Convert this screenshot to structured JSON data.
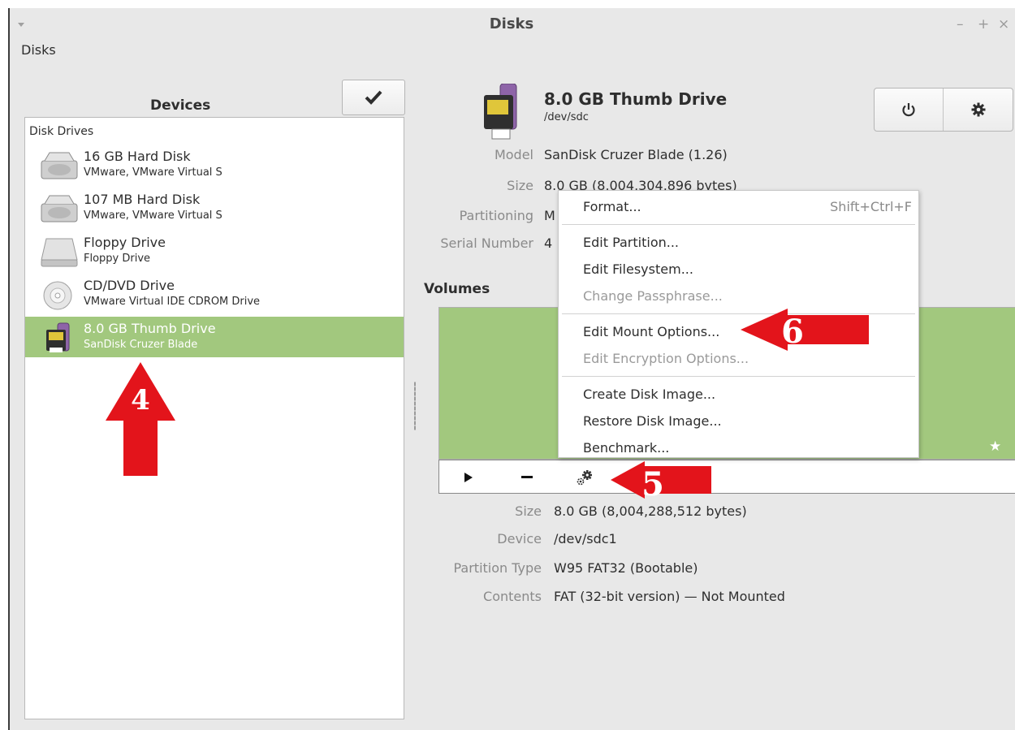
{
  "window": {
    "title": "Disks",
    "menubar_label": "Disks",
    "buttons": {
      "minimize": "–",
      "maximize": "+",
      "close": "×"
    }
  },
  "devices_panel": {
    "header": "Devices",
    "check_icon": "checkmark-icon",
    "section": "Disk Drives",
    "items": [
      {
        "name": "16 GB Hard Disk",
        "sub": "VMware, VMware Virtual S",
        "icon": "hard-disk-icon"
      },
      {
        "name": "107 MB Hard Disk",
        "sub": "VMware, VMware Virtual S",
        "icon": "hard-disk-icon"
      },
      {
        "name": "Floppy Drive",
        "sub": "Floppy Drive",
        "icon": "floppy-drive-icon"
      },
      {
        "name": "CD/DVD Drive",
        "sub": "VMware Virtual IDE CDROM Drive",
        "icon": "optical-drive-icon"
      },
      {
        "name": "8.0 GB Thumb Drive",
        "sub": "SanDisk Cruzer Blade",
        "icon": "thumb-drive-icon",
        "selected": true
      }
    ]
  },
  "drive": {
    "title": "8.0 GB Thumb Drive",
    "path": "/dev/sdc",
    "power_icon": "power-icon",
    "settings_icon": "gear-icon",
    "props": [
      {
        "label": "Model",
        "value": "SanDisk Cruzer Blade (1.26)"
      },
      {
        "label": "Size",
        "value": "8.0 GB (8,004,304,896 bytes)"
      },
      {
        "label": "Partitioning",
        "value": "M"
      },
      {
        "label": "Serial Number",
        "value": "4"
      }
    ]
  },
  "volumes": {
    "label": "Volumes",
    "star_icon": "star-icon",
    "toolbar": {
      "play": "play-icon",
      "remove": "minus-icon",
      "more": "gears-icon"
    },
    "props": [
      {
        "label": "Size",
        "value": "8.0 GB (8,004,288,512 bytes)"
      },
      {
        "label": "Device",
        "value": "/dev/sdc1"
      },
      {
        "label": "Partition Type",
        "value": "W95 FAT32 (Bootable)"
      },
      {
        "label": "Contents",
        "value": "FAT (32-bit version) — Not Mounted"
      }
    ]
  },
  "context_menu": {
    "items": [
      {
        "label": "Format...",
        "accel": "Shift+Ctrl+F",
        "enabled": true
      },
      {
        "label": "Edit Partition...",
        "enabled": true
      },
      {
        "label": "Edit Filesystem...",
        "enabled": true
      },
      {
        "label": "Change Passphrase...",
        "enabled": false
      },
      {
        "label": "Edit Mount Options...",
        "enabled": true
      },
      {
        "label": "Edit Encryption Options...",
        "enabled": false
      },
      {
        "label": "Create Disk Image...",
        "enabled": true
      },
      {
        "label": "Restore Disk Image...",
        "enabled": true
      },
      {
        "label": "Benchmark...",
        "enabled": true
      }
    ]
  },
  "annotations": {
    "arrow_4": "4",
    "arrow_5": "5",
    "arrow_6": "6",
    "color": "#e3141b"
  },
  "colors": {
    "selection": "#a2c87e",
    "window_bg": "#e8e8e8"
  }
}
